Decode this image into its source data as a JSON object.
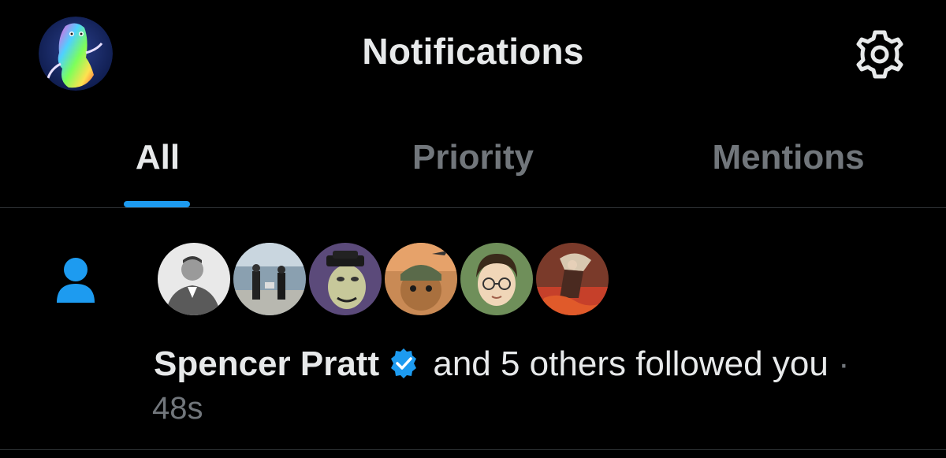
{
  "header": {
    "title": "Notifications",
    "avatar_icon": "user-avatar-rainbow-character",
    "settings_icon": "gear-icon"
  },
  "tabs": [
    {
      "label": "All",
      "active": true
    },
    {
      "label": "Priority",
      "active": false
    },
    {
      "label": "Mentions",
      "active": false
    }
  ],
  "notification": {
    "type_icon": "person-icon",
    "actor_name": "Spencer Pratt",
    "verified": true,
    "action": "and 5 others followed you",
    "separator": "·",
    "time": "48s",
    "follower_avatars": [
      "avatar-man-in-suit",
      "avatar-group-photo",
      "avatar-ape-nft",
      "avatar-cat-pilot",
      "avatar-boy-with-glasses",
      "avatar-red-painting"
    ]
  },
  "colors": {
    "background": "#000000",
    "text_primary": "#e7e9ea",
    "text_secondary": "#71767b",
    "accent": "#1d9bf0",
    "divider": "#2f3336"
  }
}
